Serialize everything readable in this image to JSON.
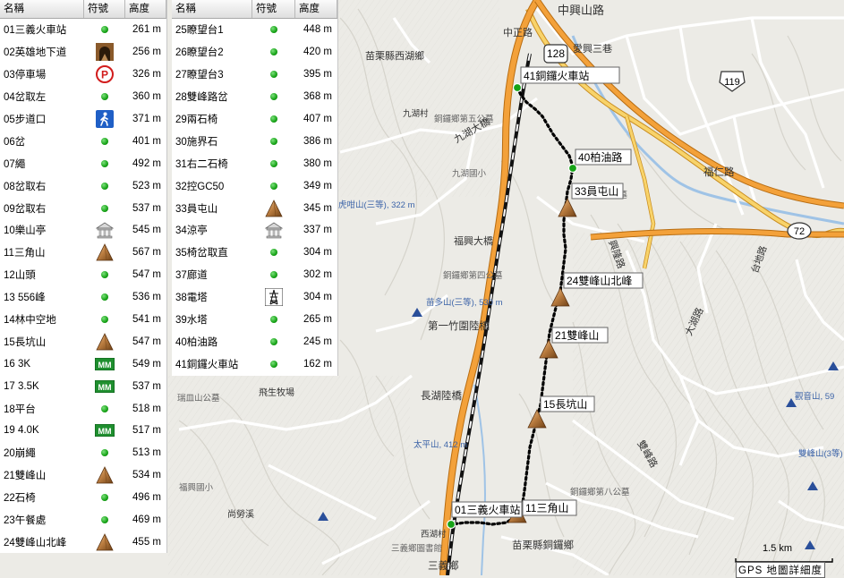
{
  "table_headers": {
    "name": "名稱",
    "symbol": "符號",
    "elevation": "高度"
  },
  "waypoints_left": [
    {
      "name": "01三義火車站",
      "elev": "261 m",
      "icon": "dot"
    },
    {
      "name": "02英雄地下道",
      "elev": "256 m",
      "icon": "tunnel"
    },
    {
      "name": "03停車場",
      "elev": "326 m",
      "icon": "parking"
    },
    {
      "name": "04岔取左",
      "elev": "360 m",
      "icon": "dot"
    },
    {
      "name": "05步道口",
      "elev": "371 m",
      "icon": "hiker"
    },
    {
      "name": "06岔",
      "elev": "401 m",
      "icon": "dot"
    },
    {
      "name": "07繩",
      "elev": "492 m",
      "icon": "dot"
    },
    {
      "name": "08岔取右",
      "elev": "523 m",
      "icon": "dot"
    },
    {
      "name": "09岔取右",
      "elev": "537 m",
      "icon": "dot"
    },
    {
      "name": "10樂山亭",
      "elev": "545 m",
      "icon": "pavilion"
    },
    {
      "name": "11三角山",
      "elev": "567 m",
      "icon": "peak"
    },
    {
      "name": "12山頭",
      "elev": "547 m",
      "icon": "dot"
    },
    {
      "name": "13 556峰",
      "elev": "536 m",
      "icon": "dot"
    },
    {
      "name": "14林中空地",
      "elev": "541 m",
      "icon": "dot"
    },
    {
      "name": "15長坑山",
      "elev": "547 m",
      "icon": "peak"
    },
    {
      "name": "16 3K",
      "elev": "549 m",
      "icon": "mile"
    },
    {
      "name": "17 3.5K",
      "elev": "537 m",
      "icon": "mile"
    },
    {
      "name": "18平台",
      "elev": "518 m",
      "icon": "dot"
    },
    {
      "name": "19 4.0K",
      "elev": "517 m",
      "icon": "mile"
    },
    {
      "name": "20崩繩",
      "elev": "513 m",
      "icon": "dot"
    },
    {
      "name": "21雙峰山",
      "elev": "534 m",
      "icon": "peak"
    },
    {
      "name": "22石椅",
      "elev": "496 m",
      "icon": "dot"
    },
    {
      "name": "23午餐處",
      "elev": "469 m",
      "icon": "dot"
    },
    {
      "name": "24雙峰山北峰",
      "elev": "455 m",
      "icon": "peak"
    }
  ],
  "waypoints_right": [
    {
      "name": "25瞭望台1",
      "elev": "448 m",
      "icon": "dot"
    },
    {
      "name": "26瞭望台2",
      "elev": "420 m",
      "icon": "dot"
    },
    {
      "name": "27瞭望台3",
      "elev": "395 m",
      "icon": "dot"
    },
    {
      "name": "28雙峰路岔",
      "elev": "368 m",
      "icon": "dot"
    },
    {
      "name": "29兩石椅",
      "elev": "407 m",
      "icon": "dot"
    },
    {
      "name": "30施界石",
      "elev": "386 m",
      "icon": "dot"
    },
    {
      "name": "31右二石椅",
      "elev": "380 m",
      "icon": "dot"
    },
    {
      "name": "32控GC50",
      "elev": "349 m",
      "icon": "dot"
    },
    {
      "name": "33員屯山",
      "elev": "345 m",
      "icon": "peak"
    },
    {
      "name": "34涼亭",
      "elev": "337 m",
      "icon": "pavilion"
    },
    {
      "name": "35椅岔取直",
      "elev": "304 m",
      "icon": "dot"
    },
    {
      "name": "37廊道",
      "elev": "302 m",
      "icon": "dot"
    },
    {
      "name": "38電塔",
      "elev": "304 m",
      "icon": "tower"
    },
    {
      "name": "39水塔",
      "elev": "265 m",
      "icon": "dot"
    },
    {
      "name": "40柏油路",
      "elev": "245 m",
      "icon": "dot"
    },
    {
      "name": "41銅鑼火車站",
      "elev": "162 m",
      "icon": "dot"
    }
  ],
  "map_labels": {
    "zhongzheng_road": "中正路",
    "zhongping_road": "中興山路",
    "aixing_road": "愛興三巷",
    "miaoli_west": "苗栗縣西湖鄉",
    "tongluo_cemetery": "銅鑼鄉第五公墓",
    "jiuhu_bridge": "九湖大橋",
    "jiuhu_school": "九湖國小",
    "huhe_road": "虎咁山(三等), 322 m",
    "fuxing_bridge": "福興大橋",
    "tongluo_4th": "銅鑼鄉第四公墓",
    "miaoduo_shan": "苗多山(三等), 530 m",
    "diyi_bridge": "第一竹圍陸橋",
    "changpi_bridge": "長湖陸橋",
    "feisheng_ranch": "飛生牧場",
    "ruilin_cemetery": "瑞皿山公墓",
    "taiping_shan": "太平山, 412 m",
    "fuxing_school": "福興國小",
    "xiangmei": "尚勞溪",
    "tongluo_8th": "銅鑼鄉第八公墓",
    "miaoli_tongluo": "苗栗縣銅鑼鄉",
    "sanyi_town": "三義鄉",
    "sanyi_library": "三義鄉圖書館",
    "zhoushan_road": "雙峰路",
    "fuxing_road": "福仁路",
    "xinglong_road": "興隆路",
    "dahu_road": "大湖路",
    "taixi_road": "台地路",
    "guanyinshan": "觀音山, 59",
    "shuangfeng_side": "雙峰山(3等)",
    "road_128": "128",
    "road_119": "119",
    "road_72": "72",
    "gongmu_12": "公墓",
    "changtian": "長坑山",
    "jiuhu_road": "九湖村",
    "xihu": "西湖村",
    "tieba": "鐵路",
    "gtsa": "苗栗鐵路"
  },
  "route_labels": [
    "41銅鑼火車站",
    "40柏油路",
    "33員屯山",
    "24雙峰山北峰",
    "21雙峰山",
    "15長坑山",
    "11三角山",
    "01三義火車站"
  ],
  "scale": {
    "distance": "1.5 km",
    "caption": "GPS 地圖詳細度"
  },
  "colors": {
    "major_road": "#f3a13a",
    "secondary_road": "#f8d36a",
    "minor_road": "#ffffff",
    "river": "#9fc3e6",
    "terrain": "#ecebe6",
    "railway": "#111111",
    "track": "#000000",
    "waypoint_dot": "#17a317",
    "peak": "#a36b34"
  }
}
